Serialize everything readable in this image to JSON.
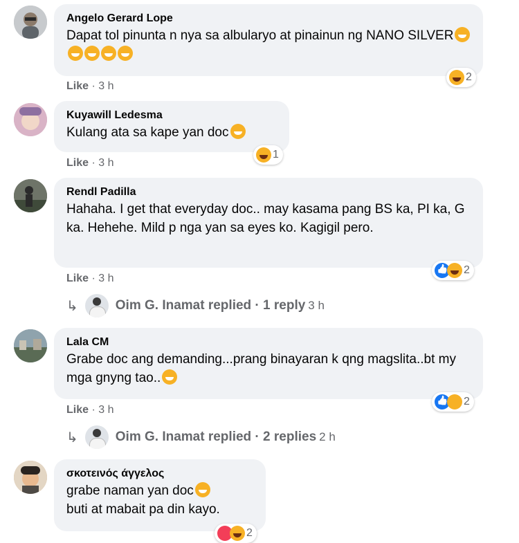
{
  "comments": [
    {
      "author": "Angelo Gerard Lope",
      "text": "Dapat tol pinunta n nya sa albularyo at pinainun ng NANO SILVER",
      "like_label": "Like",
      "time": "3 h",
      "reaction_count": "2",
      "reactions": [
        "haha-icon"
      ],
      "avatar_color": "#b5b8bb"
    },
    {
      "author": "Kuyawill Ledesma",
      "text": "Kulang ata sa kape yan doc",
      "like_label": "Like",
      "time": "3 h",
      "reaction_count": "1",
      "reactions": [
        "haha-icon"
      ],
      "avatar_color": "#d9b3c6"
    },
    {
      "author": "Rendl Padilla",
      "text": "Hahaha. I get that everyday doc.. may kasama pang BS ka, PI ka, G ka. Hehehe. Mild p nga yan sa eyes ko. Kagigil pero.",
      "like_label": "Like",
      "time": "3 h",
      "reaction_count": "2",
      "reactions": [
        "like-icon",
        "haha-icon"
      ],
      "reply_label": "Oim G. Inamat replied · 1 reply",
      "reply_time": "3 h",
      "avatar_color": "#4a4f44"
    },
    {
      "author": "Lala CM",
      "text": "Grabe doc ang demanding...prang binayaran k qng magslita..bt my mga gnyng tao..",
      "like_label": "Like",
      "time": "3 h",
      "reaction_count": "2",
      "reactions": [
        "like-icon",
        "care-icon"
      ],
      "reply_label": "Oim G. Inamat replied · 2 replies",
      "reply_time": "2 h",
      "avatar_color": "#7d8a8f"
    },
    {
      "author": "σκοτεινός άγγελος",
      "text": "grabe naman yan doc",
      "text2": "buti at mabait pa din kayo.",
      "reaction_count": "2",
      "reactions": [
        "love-icon",
        "haha-icon"
      ],
      "avatar_color": "#c9a27a"
    }
  ],
  "colors": {
    "bubble": "#f0f2f5",
    "meta_text": "#65676b",
    "like_blue": "#1877f2",
    "haha_yellow": "#f7b125",
    "love_red": "#f33e58"
  }
}
